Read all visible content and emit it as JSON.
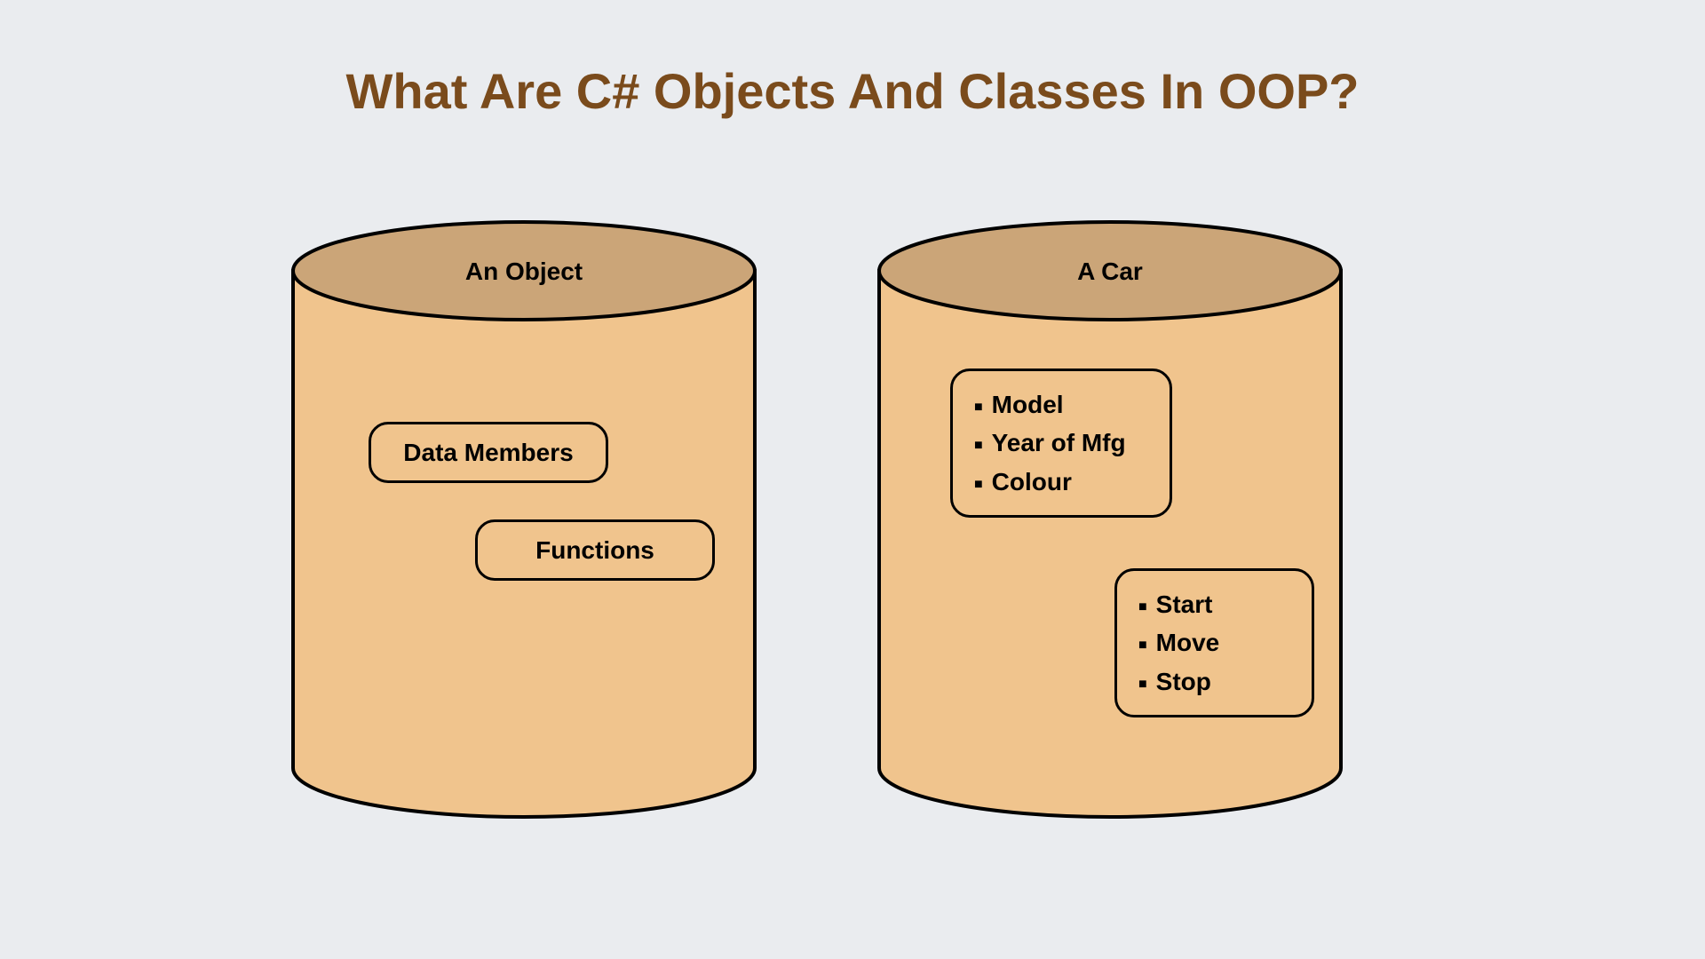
{
  "title": "What Are C# Objects And Classes In OOP?",
  "left": {
    "label": "An Object",
    "box1": "Data Members",
    "box2": "Functions"
  },
  "right": {
    "label": "A Car",
    "attributes": [
      "Model",
      "Year of Mfg",
      "Colour"
    ],
    "methods": [
      "Start",
      "Move",
      "Stop"
    ]
  },
  "colors": {
    "body_fill": "#f0c48d",
    "top_fill": "#cba578",
    "stroke": "#000000",
    "title_color": "#7a4b1c",
    "background": "#eaecef"
  }
}
